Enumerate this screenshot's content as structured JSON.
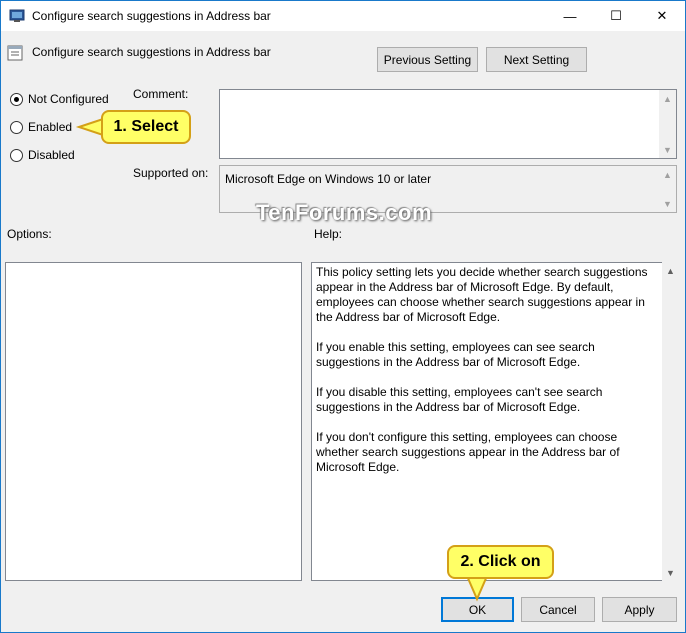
{
  "window": {
    "title": "Configure search suggestions in Address bar",
    "controls": {
      "minimize": "—",
      "maximize": "☐",
      "close": "✕"
    }
  },
  "header": {
    "setting_title": "Configure search suggestions in Address bar",
    "previous_label": "Previous Setting",
    "next_label": "Next Setting"
  },
  "state": {
    "options": [
      {
        "label": "Not Configured",
        "checked": true
      },
      {
        "label": "Enabled",
        "checked": false
      },
      {
        "label": "Disabled",
        "checked": false
      }
    ]
  },
  "comment": {
    "label": "Comment:",
    "value": ""
  },
  "supported": {
    "label": "Supported on:",
    "value": "Microsoft Edge on Windows 10 or later"
  },
  "watermark": "TenForums.com",
  "options_label": "Options:",
  "help_label": "Help:",
  "help_paragraphs": [
    "This policy setting lets you decide whether search suggestions appear in the Address bar of Microsoft Edge. By default, employees can choose whether search suggestions appear in the Address bar of Microsoft Edge.",
    "If you enable this setting, employees can see search suggestions in the Address bar of Microsoft Edge.",
    "If you disable this setting, employees can't see search suggestions in the Address bar of Microsoft Edge.",
    "If you don't configure this setting, employees can choose whether search suggestions appear in the Address bar of Microsoft Edge."
  ],
  "footer": {
    "ok_label": "OK",
    "cancel_label": "Cancel",
    "apply_label": "Apply"
  },
  "callouts": {
    "select": "1. Select",
    "click": "2. Click on"
  },
  "colors": {
    "accent": "#0078d7",
    "callout_fill": "#ffff66",
    "callout_border": "#d4a017"
  }
}
